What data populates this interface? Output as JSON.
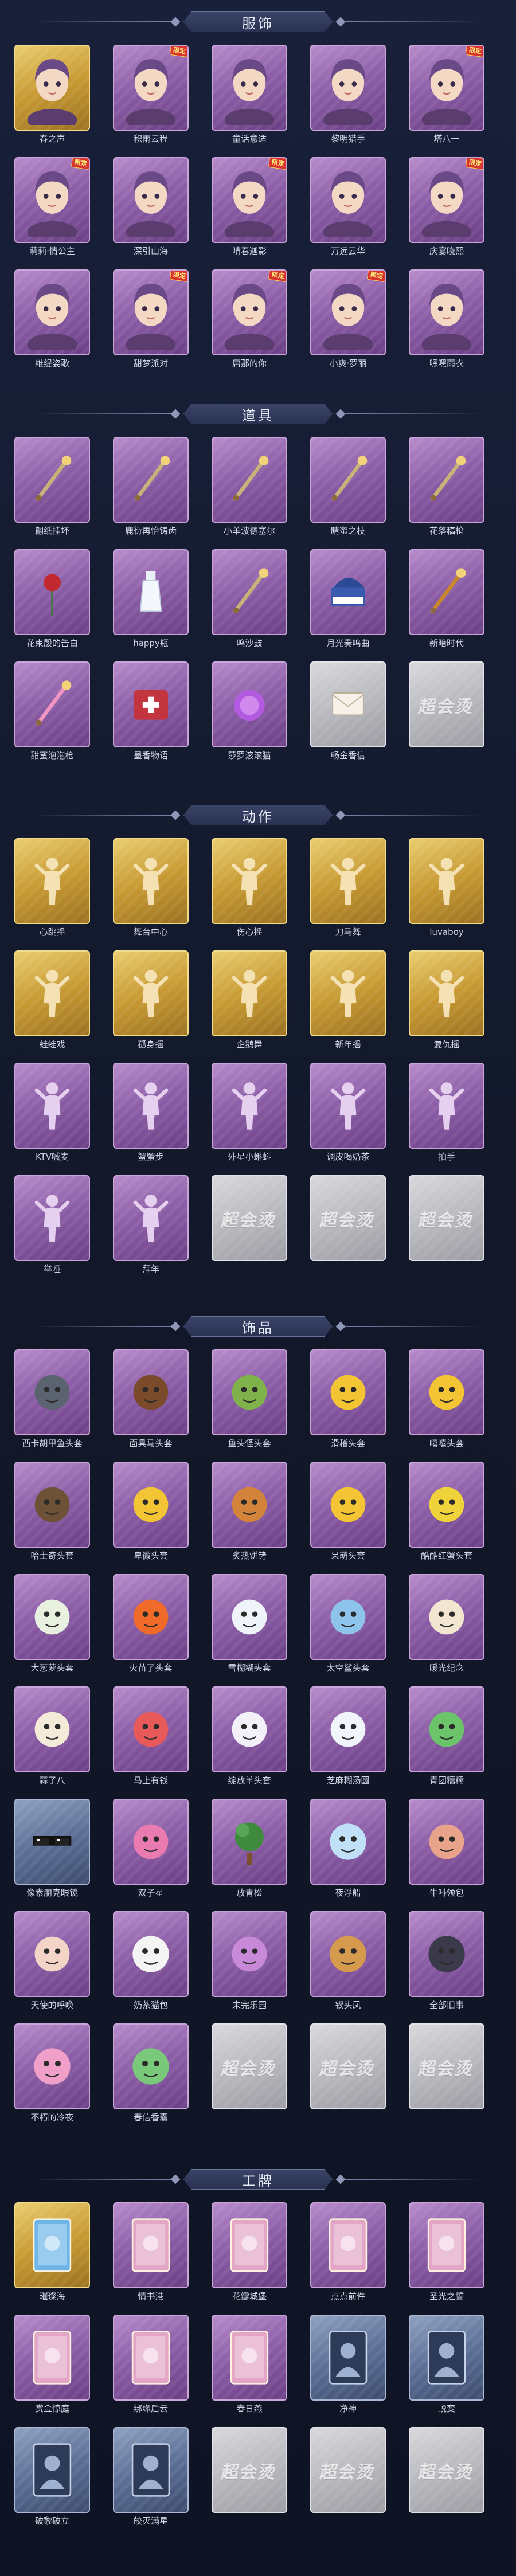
{
  "colors": {
    "background": "#141a2b",
    "purple_frame": "#8d5fa8",
    "gold_frame": "#c89a33",
    "blue_frame": "#5c6f96",
    "empty_frame": "#b9babf",
    "label_text": "#cfd4e4",
    "limited_tag": "#d8332f"
  },
  "empty_slot_text": "超会烫",
  "sections": [
    {
      "title": "服饰",
      "items": [
        {
          "name": "春之声",
          "rarity": "gold",
          "icon": "costume-portrait-icon",
          "tag": ""
        },
        {
          "name": "积雨云程",
          "rarity": "purple",
          "icon": "costume-portrait-icon",
          "tag": "限定"
        },
        {
          "name": "童话意适",
          "rarity": "purple",
          "icon": "costume-portrait-icon",
          "tag": ""
        },
        {
          "name": "黎明猎手",
          "rarity": "purple",
          "icon": "costume-portrait-icon",
          "tag": ""
        },
        {
          "name": "塔八一",
          "rarity": "purple",
          "icon": "costume-portrait-icon",
          "tag": "限定"
        },
        {
          "name": "莉莉·情公主",
          "rarity": "purple",
          "icon": "costume-portrait-icon",
          "tag": "限定"
        },
        {
          "name": "深引山海",
          "rarity": "purple",
          "icon": "costume-portrait-icon",
          "tag": ""
        },
        {
          "name": "晴春迦影",
          "rarity": "purple",
          "icon": "costume-portrait-icon",
          "tag": "限定"
        },
        {
          "name": "万远云华",
          "rarity": "purple",
          "icon": "costume-portrait-icon",
          "tag": ""
        },
        {
          "name": "庆宴晓熙",
          "rarity": "purple",
          "icon": "costume-portrait-icon",
          "tag": "限定"
        },
        {
          "name": "维缇姿歌",
          "rarity": "purple",
          "icon": "costume-portrait-icon",
          "tag": ""
        },
        {
          "name": "甜梦派对",
          "rarity": "purple",
          "icon": "costume-portrait-icon",
          "tag": "限定"
        },
        {
          "name": "庸那的你",
          "rarity": "purple",
          "icon": "costume-portrait-icon",
          "tag": "限定"
        },
        {
          "name": "小爽·罗丽",
          "rarity": "purple",
          "icon": "costume-portrait-icon",
          "tag": "限定"
        },
        {
          "name": "嘿嘿雨衣",
          "rarity": "purple",
          "icon": "costume-portrait-icon",
          "tag": ""
        }
      ]
    },
    {
      "title": "道具",
      "items": [
        {
          "name": "翩纸挂坏",
          "rarity": "purple",
          "icon": "staff-icon",
          "tag": ""
        },
        {
          "name": "鹿衍再怡铸齿",
          "rarity": "purple",
          "icon": "trident-icon",
          "tag": ""
        },
        {
          "name": "小羊波德塞尔",
          "rarity": "purple",
          "icon": "scepter-icon",
          "tag": ""
        },
        {
          "name": "睛蜜之枝",
          "rarity": "purple",
          "icon": "branch-icon",
          "tag": ""
        },
        {
          "name": "花落稿枪",
          "rarity": "purple",
          "icon": "flower-staff-icon",
          "tag": ""
        },
        {
          "name": "花束殷的告白",
          "rarity": "purple",
          "icon": "rose-icon",
          "tag": ""
        },
        {
          "name": "happy瓶",
          "rarity": "purple",
          "icon": "bottle-icon",
          "tag": ""
        },
        {
          "name": "鸣沙鼓",
          "rarity": "purple",
          "icon": "dreamcatcher-icon",
          "tag": ""
        },
        {
          "name": "月光奏鸣曲",
          "rarity": "purple",
          "icon": "piano-icon",
          "tag": ""
        },
        {
          "name": "新暗时代",
          "rarity": "purple",
          "icon": "revolver-icon",
          "tag": ""
        },
        {
          "name": "甜蜜泡泡枪",
          "rarity": "purple",
          "icon": "bubble-gun-icon",
          "tag": ""
        },
        {
          "name": "墨香物语",
          "rarity": "purple",
          "icon": "first-aid-box-icon",
          "tag": ""
        },
        {
          "name": "莎罗滚滚猫",
          "rarity": "purple",
          "icon": "orb-cat-icon",
          "tag": ""
        },
        {
          "name": "畅金香信",
          "rarity": "empty",
          "icon": "letter-icon",
          "tag": ""
        },
        {
          "name": "",
          "rarity": "empty",
          "icon": "",
          "tag": ""
        }
      ]
    },
    {
      "title": "动作",
      "items": [
        {
          "name": "心跳摇",
          "rarity": "gold",
          "icon": "emote-pose-icon",
          "tag": ""
        },
        {
          "name": "舞台中心",
          "rarity": "gold",
          "icon": "emote-pose-icon",
          "tag": ""
        },
        {
          "name": "伤心摇",
          "rarity": "gold",
          "icon": "emote-pose-icon",
          "tag": ""
        },
        {
          "name": "刀马舞",
          "rarity": "gold",
          "icon": "emote-pose-icon",
          "tag": ""
        },
        {
          "name": "luvaboy",
          "rarity": "gold",
          "icon": "emote-pose-icon",
          "tag": ""
        },
        {
          "name": "蛙蛙戏",
          "rarity": "gold",
          "icon": "emote-pose-icon",
          "tag": ""
        },
        {
          "name": "孤身摇",
          "rarity": "gold",
          "icon": "emote-pose-icon",
          "tag": ""
        },
        {
          "name": "企鹅舞",
          "rarity": "gold",
          "icon": "emote-pose-icon",
          "tag": ""
        },
        {
          "name": "新年摇",
          "rarity": "gold",
          "icon": "emote-pose-icon",
          "tag": ""
        },
        {
          "name": "复仇摇",
          "rarity": "gold",
          "icon": "emote-pose-icon",
          "tag": ""
        },
        {
          "name": "KTV喊麦",
          "rarity": "purple",
          "icon": "emote-pose-icon",
          "tag": ""
        },
        {
          "name": "蟹蟹步",
          "rarity": "purple",
          "icon": "emote-pose-icon",
          "tag": ""
        },
        {
          "name": "外星小蝌蚪",
          "rarity": "purple",
          "icon": "emote-pose-icon",
          "tag": ""
        },
        {
          "name": "调皮喝奶茶",
          "rarity": "purple",
          "icon": "emote-pose-icon",
          "tag": ""
        },
        {
          "name": "拍手",
          "rarity": "purple",
          "icon": "emote-pose-icon",
          "tag": ""
        },
        {
          "name": "举哑",
          "rarity": "purple",
          "icon": "emote-pose-icon",
          "tag": ""
        },
        {
          "name": "拜年",
          "rarity": "purple",
          "icon": "emote-pose-icon",
          "tag": ""
        },
        {
          "name": "",
          "rarity": "empty",
          "icon": "",
          "tag": ""
        },
        {
          "name": "",
          "rarity": "empty",
          "icon": "",
          "tag": ""
        },
        {
          "name": "",
          "rarity": "empty",
          "icon": "",
          "tag": ""
        }
      ]
    },
    {
      "title": "饰品",
      "items": [
        {
          "name": "西卡胡甲鱼头套",
          "rarity": "purple",
          "icon": "seal-head-icon",
          "tag": ""
        },
        {
          "name": "面具马头套",
          "rarity": "purple",
          "icon": "horse-head-icon",
          "tag": ""
        },
        {
          "name": "鱼头怪头套",
          "rarity": "purple",
          "icon": "fish-head-icon",
          "tag": ""
        },
        {
          "name": "滑稽头套",
          "rarity": "purple",
          "icon": "smiley-head-icon",
          "tag": ""
        },
        {
          "name": "嘻嘻头套",
          "rarity": "purple",
          "icon": "grin-head-icon",
          "tag": ""
        },
        {
          "name": "哈士奇头套",
          "rarity": "purple",
          "icon": "dog-head-icon",
          "tag": ""
        },
        {
          "name": "卑微头套",
          "rarity": "purple",
          "icon": "sad-face-head-icon",
          "tag": ""
        },
        {
          "name": "炙热饼铐",
          "rarity": "purple",
          "icon": "cookie-head-icon",
          "tag": ""
        },
        {
          "name": "呆萌头套",
          "rarity": "purple",
          "icon": "shocked-face-head-icon",
          "tag": ""
        },
        {
          "name": "酷酷红蟹头套",
          "rarity": "purple",
          "icon": "pikachu-head-icon",
          "tag": ""
        },
        {
          "name": "大葱萝头套",
          "rarity": "purple",
          "icon": "radish-head-icon",
          "tag": ""
        },
        {
          "name": "火苗了头套",
          "rarity": "purple",
          "icon": "flame-head-icon",
          "tag": ""
        },
        {
          "name": "雪糊糊头套",
          "rarity": "purple",
          "icon": "snowman-head-icon",
          "tag": ""
        },
        {
          "name": "太空鲨头套",
          "rarity": "purple",
          "icon": "shark-head-icon",
          "tag": ""
        },
        {
          "name": "暖光纪念",
          "rarity": "purple",
          "icon": "candle-head-icon",
          "tag": ""
        },
        {
          "name": "蒜了八",
          "rarity": "purple",
          "icon": "garlic-head-icon",
          "tag": ""
        },
        {
          "name": "马上有钱",
          "rarity": "purple",
          "icon": "horse-doll-icon",
          "tag": ""
        },
        {
          "name": "绽放羊头套",
          "rarity": "purple",
          "icon": "sheep-head-icon",
          "tag": ""
        },
        {
          "name": "芝麻糊汤圆",
          "rarity": "purple",
          "icon": "dumpling-head-icon",
          "tag": ""
        },
        {
          "name": "青团糯糯",
          "rarity": "purple",
          "icon": "green-bun-head-icon",
          "tag": ""
        },
        {
          "name": "像素朋克眼镜",
          "rarity": "blue",
          "icon": "pixel-glasses-icon",
          "tag": ""
        },
        {
          "name": "双子星",
          "rarity": "purple",
          "icon": "twin-doll-icon",
          "tag": ""
        },
        {
          "name": "放青松",
          "rarity": "purple",
          "icon": "pine-tree-icon",
          "tag": ""
        },
        {
          "name": "夜浮船",
          "rarity": "purple",
          "icon": "crystal-ship-icon",
          "tag": ""
        },
        {
          "name": "牛啡领包",
          "rarity": "purple",
          "icon": "cake-head-icon",
          "tag": ""
        },
        {
          "name": "天使的呼唤",
          "rarity": "purple",
          "icon": "angel-doll-icon",
          "tag": ""
        },
        {
          "name": "奶茶猫包",
          "rarity": "purple",
          "icon": "qr-bag-icon",
          "tag": ""
        },
        {
          "name": "未完乐园",
          "rarity": "purple",
          "icon": "clown-doll-icon",
          "tag": ""
        },
        {
          "name": "钗头凤",
          "rarity": "purple",
          "icon": "phoenix-crown-icon",
          "tag": ""
        },
        {
          "name": "全部旧事",
          "rarity": "purple",
          "icon": "mini-figure-icon",
          "tag": ""
        },
        {
          "name": "不朽的冷夜",
          "rarity": "purple",
          "icon": "pink-creature-icon",
          "tag": ""
        },
        {
          "name": "春信香囊",
          "rarity": "purple",
          "icon": "sachet-icon",
          "tag": ""
        },
        {
          "name": "",
          "rarity": "empty",
          "icon": "",
          "tag": ""
        },
        {
          "name": "",
          "rarity": "empty",
          "icon": "",
          "tag": ""
        },
        {
          "name": "",
          "rarity": "empty",
          "icon": "",
          "tag": ""
        }
      ]
    },
    {
      "title": "工牌",
      "items": [
        {
          "name": "璀璨海",
          "rarity": "gold",
          "icon": "crystal-badge-icon",
          "tag": ""
        },
        {
          "name": "情书港",
          "rarity": "purple",
          "icon": "love-letter-badge-icon",
          "tag": ""
        },
        {
          "name": "花瓣城堡",
          "rarity": "purple",
          "icon": "castle-badge-icon",
          "tag": ""
        },
        {
          "name": "点点前件",
          "rarity": "purple",
          "icon": "landscape-badge-icon",
          "tag": ""
        },
        {
          "name": "圣光之誓",
          "rarity": "purple",
          "icon": "holy-badge-icon",
          "tag": ""
        },
        {
          "name": "赏金惊庭",
          "rarity": "purple",
          "icon": "bounty-badge-icon",
          "tag": ""
        },
        {
          "name": "绑缘后云",
          "rarity": "purple",
          "icon": "bride-badge-icon",
          "tag": ""
        },
        {
          "name": "春日燕",
          "rarity": "purple",
          "icon": "spring-badge-icon",
          "tag": ""
        },
        {
          "name": "净神",
          "rarity": "blue",
          "icon": "silhouette-badge-icon",
          "tag": ""
        },
        {
          "name": "蜕变",
          "rarity": "blue",
          "icon": "silhouette-badge-icon",
          "tag": ""
        },
        {
          "name": "破黎破立",
          "rarity": "blue",
          "icon": "silhouette-badge-icon",
          "tag": ""
        },
        {
          "name": "皎灭满星",
          "rarity": "blue",
          "icon": "silhouette-badge-icon",
          "tag": ""
        },
        {
          "name": "",
          "rarity": "empty",
          "icon": "",
          "tag": ""
        },
        {
          "name": "",
          "rarity": "empty",
          "icon": "",
          "tag": ""
        },
        {
          "name": "",
          "rarity": "empty",
          "icon": "",
          "tag": ""
        }
      ]
    }
  ]
}
